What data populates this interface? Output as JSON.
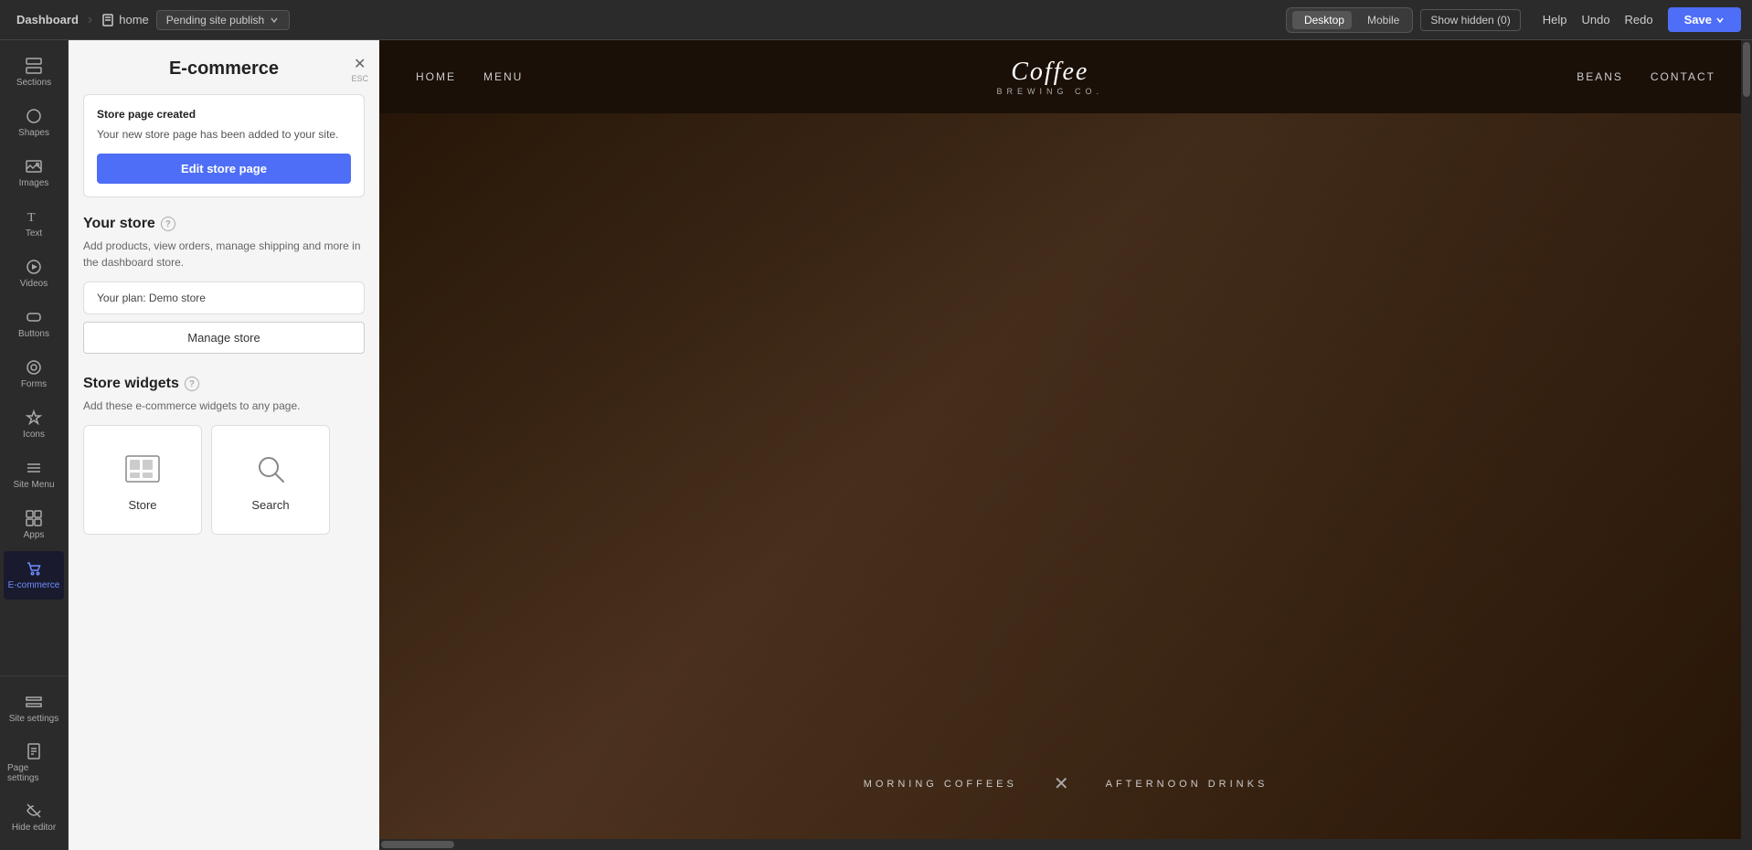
{
  "topbar": {
    "brand_label": "Dashboard",
    "home_label": "home",
    "pending_label": "Pending site publish",
    "desktop_label": "Desktop",
    "mobile_label": "Mobile",
    "show_hidden_label": "Show hidden (0)",
    "help_label": "Help",
    "undo_label": "Undo",
    "redo_label": "Redo",
    "save_label": "Save"
  },
  "sidebar": {
    "items": [
      {
        "id": "sections",
        "label": "Sections"
      },
      {
        "id": "shapes",
        "label": "Shapes"
      },
      {
        "id": "images",
        "label": "Images"
      },
      {
        "id": "text",
        "label": "Text"
      },
      {
        "id": "videos",
        "label": "Videos"
      },
      {
        "id": "buttons",
        "label": "Buttons"
      },
      {
        "id": "forms",
        "label": "Forms"
      },
      {
        "id": "icons",
        "label": "Icons"
      },
      {
        "id": "sitemenu",
        "label": "Site Menu"
      },
      {
        "id": "apps",
        "label": "Apps"
      },
      {
        "id": "ecommerce",
        "label": "E-commerce",
        "active": true
      }
    ],
    "bottom": [
      {
        "id": "site-settings",
        "label": "Site settings"
      },
      {
        "id": "page-settings",
        "label": "Page settings"
      },
      {
        "id": "hide-editor",
        "label": "Hide editor"
      }
    ]
  },
  "panel": {
    "title": "E-commerce",
    "close_label": "✕",
    "esc_label": "ESC",
    "store_created": {
      "title": "Store page created",
      "text": "Your new store page has been added to your site.",
      "edit_btn": "Edit store page"
    },
    "your_store": {
      "title": "Your store",
      "desc": "Add products, view orders, manage shipping and more in the dashboard store.",
      "plan_label": "Your plan: Demo store",
      "manage_btn": "Manage store"
    },
    "store_widgets": {
      "title": "Store widgets",
      "desc": "Add these e-commerce widgets to any page.",
      "widgets": [
        {
          "id": "store",
          "label": "Store"
        },
        {
          "id": "search",
          "label": "Search"
        }
      ]
    }
  },
  "website": {
    "nav": {
      "left_links": [
        "HOME",
        "MENU"
      ],
      "right_links": [
        "BEANS",
        "CONTACT"
      ],
      "logo_text": "Coffee",
      "logo_script": "Brewing Co.",
      "logo_sub": "BREWING CO."
    },
    "hero": {
      "tab1": "MORNING COFFEES",
      "tab2": "AFTERNOON DRINKS"
    }
  }
}
